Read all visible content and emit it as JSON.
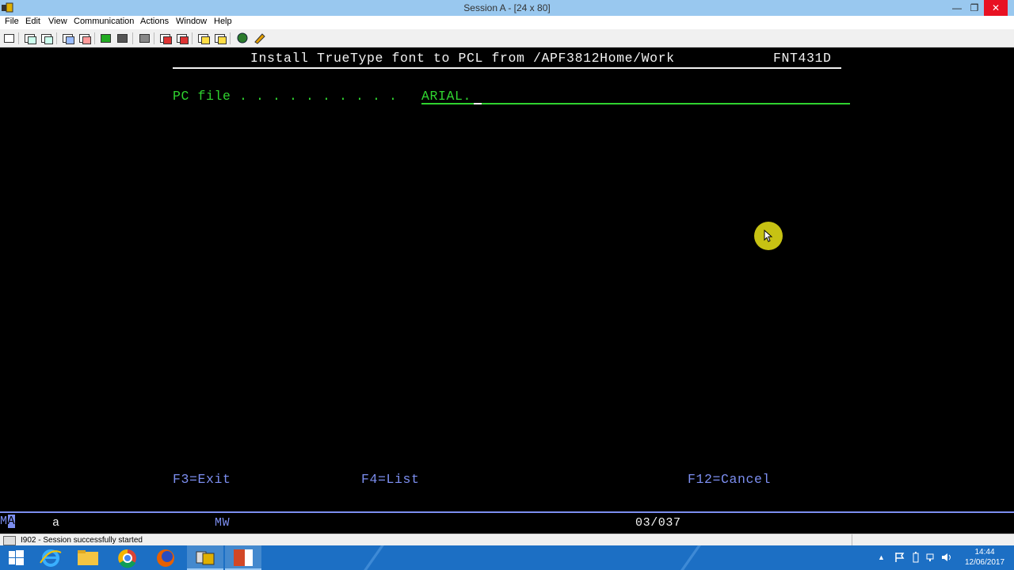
{
  "window": {
    "title": "Session A - [24 x 80]",
    "controls": {
      "minimize": "—",
      "maximize": "❐",
      "close": "✕"
    }
  },
  "menu": [
    "File",
    "Edit",
    "View",
    "Communication",
    "Actions",
    "Window",
    "Help"
  ],
  "terminal": {
    "screen_title": "Install TrueType font to PCL from /APF3812Home/Work",
    "screen_code": "FNT431D",
    "field_label": "PC file . . . . . . . . . .",
    "field_value": "ARIAL.",
    "function_keys": [
      "F3=Exit",
      "F4=List",
      "F12=Cancel"
    ],
    "colors": {
      "white": "#f2f2f2",
      "green": "#2fd22f",
      "blue": "#7c8ef0",
      "pointer": "#c7c213"
    }
  },
  "oia": {
    "mode_prefix": "M",
    "mode_highlight": "A",
    "session": "a",
    "indicator": "MW",
    "cursor_position": "03/037"
  },
  "status": {
    "message": "I902 - Session successfully started"
  },
  "taskbar": {
    "clock_time": "14:44",
    "clock_date": "12/06/2017",
    "tray_arrow": "▲",
    "color": "#1c6fc4"
  }
}
